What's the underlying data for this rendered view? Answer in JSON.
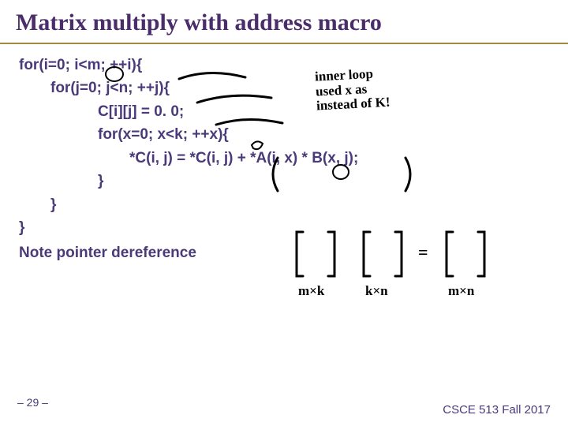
{
  "title": "Matrix multiply with address macro",
  "code": {
    "l1": "for(i=0; i<m; ++i){",
    "l2": "for(j=0; j<n; ++j){",
    "l3": "C[i][j] = 0. 0;",
    "l4": "for(x=0; x<k; ++x){",
    "l5": "*C(i, j) = *C(i, j) + *A(i, x) * B(x, j);",
    "l6": "}",
    "l7": "}",
    "l8": "}"
  },
  "note": "Note pointer dereference",
  "pagenum": "– 29 –",
  "footer": "CSCE 513 Fall 2017",
  "annotations": {
    "loop_hint": "inner loop\nused x as\ninstead of K!",
    "dim1": "m×k",
    "dim2": "k×n",
    "dim3": "m×n",
    "eq": "="
  }
}
